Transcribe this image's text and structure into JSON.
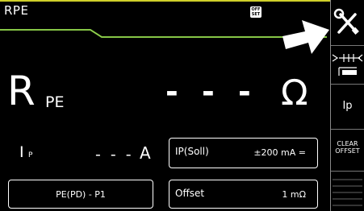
{
  "header": {
    "title": "RPE",
    "offset_icon_text": "OFF SET"
  },
  "measurement": {
    "main_symbol": "R",
    "main_subscript": "PE",
    "value": "- - -",
    "unit": "Ω"
  },
  "current": {
    "symbol": "I",
    "subscript": "P",
    "value": "- - -",
    "unit": "A"
  },
  "params": {
    "ip_soll_label": "IP(Soll)",
    "ip_soll_value": "±200 mA =",
    "offset_label": "Offset",
    "offset_value": "1 mΩ",
    "mode_value": "PE(PD) - P1"
  },
  "sidebar": {
    "ip_label": "Ip",
    "clear_offset_line1": "CLEAR",
    "clear_offset_line2": "OFFSET"
  },
  "colors": {
    "background": "#000000",
    "accent_line": "#7bbf3a",
    "top_bar": "#cfcf2a",
    "foreground": "#ffffff"
  },
  "icons": {
    "settings": "wrench-screwdriver-icon",
    "probe": "probe-connection-icon",
    "pointer": "arrow-pointer-icon"
  }
}
